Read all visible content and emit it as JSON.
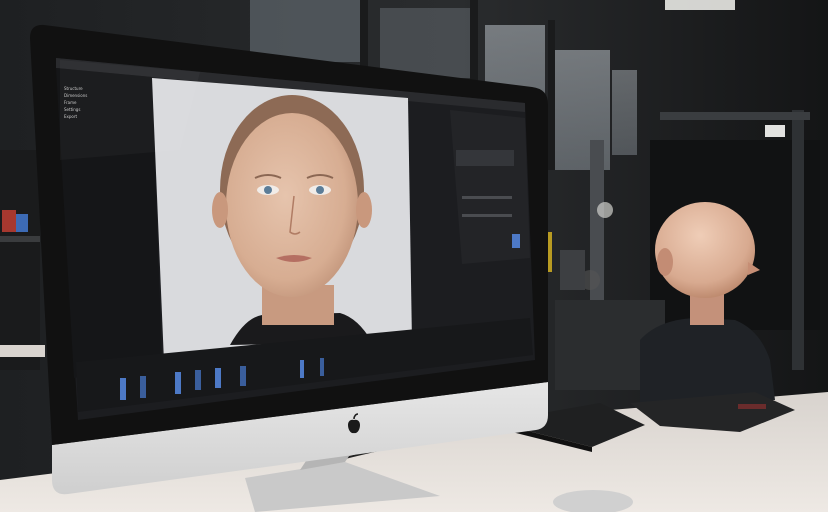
{
  "scene": {
    "kind": "photo",
    "subject": "lab workstation with monitor showing a 3D face render and a seated bald person in the background"
  },
  "monitor": {
    "brand_icon": "apple-logo-icon",
    "panel_lines": [
      "Structure",
      "Dimensions",
      "Frame",
      "Settings",
      "Export"
    ],
    "timeline_label": ""
  },
  "colors": {
    "wall": "#2a2c2e",
    "screen_bg": "#1c1d20",
    "portrait_bg": "#d9dadd",
    "desk": "#e6e1dc",
    "bezel": "#121212",
    "chin": "#d9d9d9",
    "accent_blue": "#4d79c6",
    "accent_red": "#d63030"
  }
}
